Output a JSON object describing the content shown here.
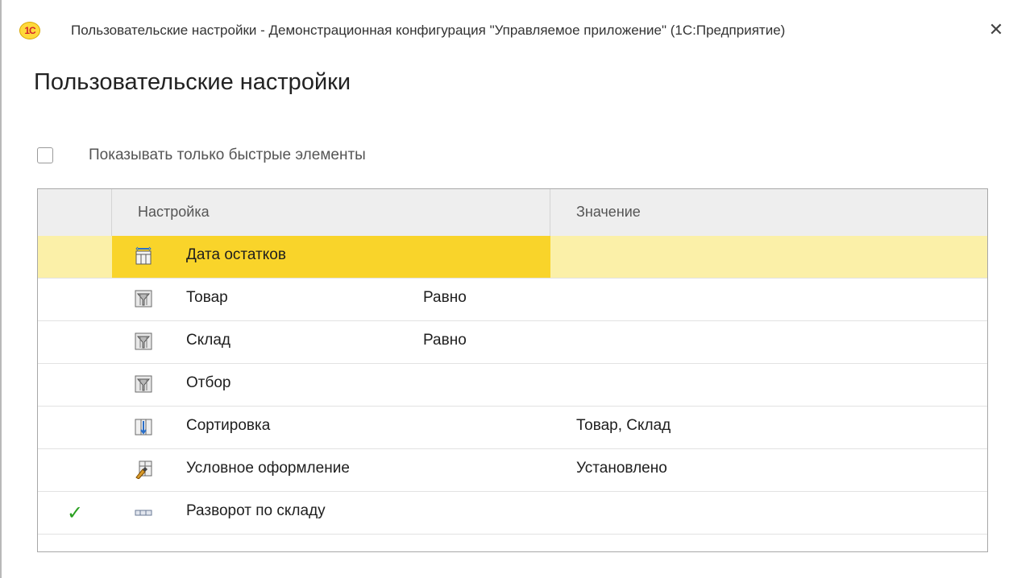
{
  "window": {
    "title": "Пользовательские настройки - Демонстрационная конфигурация \"Управляемое приложение\"  (1С:Предприятие)",
    "logo_text": "1С",
    "close_glyph": "✕"
  },
  "page": {
    "title": "Пользовательские настройки"
  },
  "quick_filter": {
    "label": "Показывать только быстрые элементы",
    "checked": false
  },
  "grid": {
    "columns": {
      "setting": "Настройка",
      "value": "Значение"
    },
    "rows": [
      {
        "icon": "calendar-date-icon",
        "label": "Дата остатков",
        "condition": "",
        "value": "",
        "checked": false,
        "selected": true
      },
      {
        "icon": "filter-icon",
        "label": "Товар",
        "condition": "Равно",
        "value": "",
        "checked": false,
        "selected": false
      },
      {
        "icon": "filter-icon",
        "label": "Склад",
        "condition": "Равно",
        "value": "",
        "checked": false,
        "selected": false
      },
      {
        "icon": "filter-icon",
        "label": "Отбор",
        "condition": "",
        "value": "",
        "checked": false,
        "selected": false
      },
      {
        "icon": "sort-icon",
        "label": "Сортировка",
        "condition": "",
        "value": "Товар, Склад",
        "checked": false,
        "selected": false
      },
      {
        "icon": "conditional-format-icon",
        "label": "Условное оформление",
        "condition": "",
        "value": "Установлено",
        "checked": false,
        "selected": false
      },
      {
        "icon": "grouping-icon",
        "label": "Разворот по складу",
        "condition": "",
        "value": "",
        "checked": true,
        "selected": false
      }
    ]
  },
  "colors": {
    "selected_row": "#fbf0a8",
    "selected_cell": "#f9d42a",
    "check_mark": "#2aa020",
    "header_bg": "#eeeeee"
  }
}
